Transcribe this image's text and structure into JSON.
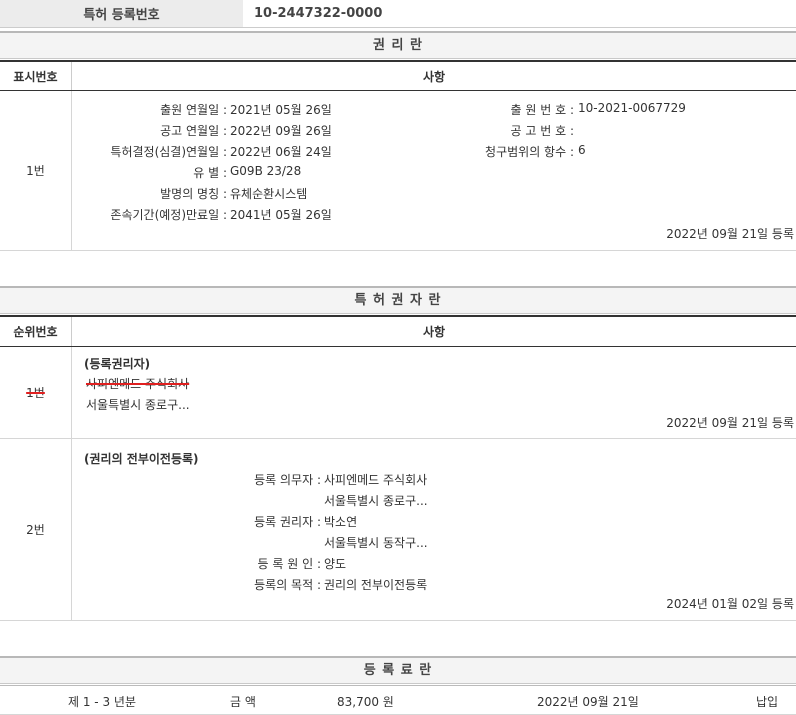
{
  "reg_no": {
    "label": "특허 등록번호",
    "value": "10-2447322-0000"
  },
  "rights": {
    "title": "권 리 란",
    "col1": "표시번호",
    "col2": "사항",
    "row": {
      "num": "1번",
      "left": [
        {
          "label": "출원 연월일 :",
          "value": "2021년 05월 26일"
        },
        {
          "label": "공고 연월일 :",
          "value": "2022년 09월 26일"
        },
        {
          "label": "특허결정(심결)연월일 :",
          "value": "2022년 06월 24일"
        },
        {
          "label": "유 별 :",
          "value": "G09B 23/28"
        },
        {
          "label": "발명의 명칭 :",
          "value": "유체순환시스템"
        },
        {
          "label": "존속기간(예정)만료일 :",
          "value": "2041년 05월 26일"
        }
      ],
      "right": [
        {
          "label": "출 원 번 호 :",
          "value": "10-2021-0067729"
        },
        {
          "label": "공 고 번 호 :",
          "value": ""
        },
        {
          "label": "청구범위의 항수 :",
          "value": "6"
        }
      ],
      "reg": "2022년 09월 21일 등록"
    }
  },
  "holders": {
    "title": "특 허 권 자 란",
    "col1": "순위번호",
    "col2": "사항",
    "row1": {
      "num": "1번",
      "heading": "(등록권리자)",
      "name": "사피엔메드 주식회사",
      "addr": "서울특별시 종로구...",
      "reg": "2022년 09월 21일 등록"
    },
    "row2": {
      "num": "2번",
      "heading": "(권리의 전부이전등록)",
      "items": [
        {
          "label": "등록 의무자 :",
          "value": "사피엔메드 주식회사"
        },
        {
          "label": "",
          "value": "서울특별시 종로구..."
        },
        {
          "label": "등록 권리자 :",
          "value": "박소연"
        },
        {
          "label": "",
          "value": "서울특별시 동작구..."
        },
        {
          "label": "등 록 원 인 :",
          "value": "양도"
        },
        {
          "label": "등록의 목적 :",
          "value": "권리의 전부이전등록"
        }
      ],
      "reg": "2024년 01월 02일 등록"
    }
  },
  "fees": {
    "title": "등 록 료 란",
    "row": {
      "period": "제 1 - 3 년분",
      "amount_label": "금 액",
      "amount": "83,700 원",
      "date": "2022년 09월 21일",
      "status": "납입"
    }
  }
}
